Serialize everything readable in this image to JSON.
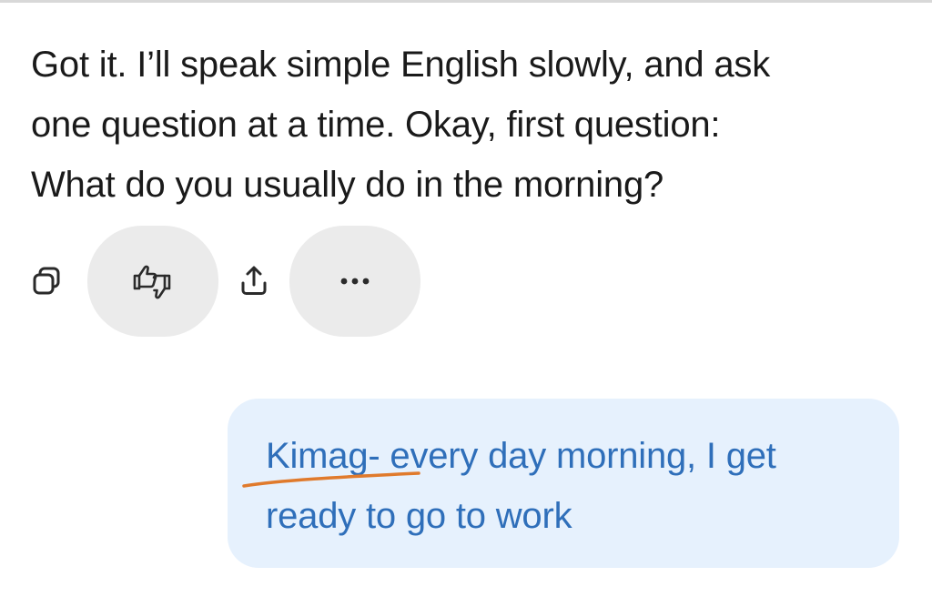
{
  "assistant": {
    "message_lines": [
      "Got it. I’ll speak simple English slowly, and ask",
      "one question at a time. Okay, first question:",
      "What do you usually do in the morning?"
    ]
  },
  "actions": {
    "copy_icon": "copy-icon",
    "feedback_icon": "thumbs-up-down-icon",
    "share_icon": "share-icon",
    "more_icon": "more-horizontal-icon"
  },
  "user": {
    "message_lines": [
      "Kimag- every day morning, I get",
      "ready to go to work"
    ]
  },
  "colors": {
    "assistant_text": "#1a1a1a",
    "user_text": "#2f6fba",
    "user_bubble": "#e6f1fd",
    "pill_button": "#ebebeb",
    "ink_annotation": "#e07a2c"
  }
}
